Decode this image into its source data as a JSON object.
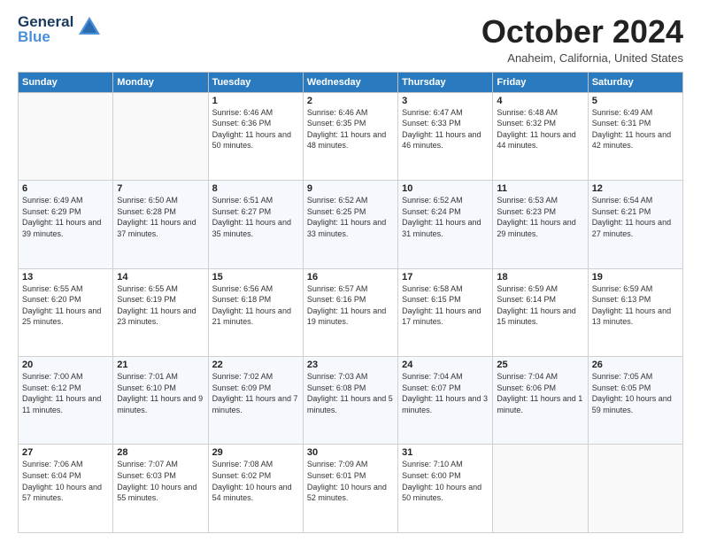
{
  "logo": {
    "line1": "General",
    "line2": "Blue"
  },
  "title": "October 2024",
  "subtitle": "Anaheim, California, United States",
  "days_of_week": [
    "Sunday",
    "Monday",
    "Tuesday",
    "Wednesday",
    "Thursday",
    "Friday",
    "Saturday"
  ],
  "weeks": [
    [
      {
        "day": "",
        "info": ""
      },
      {
        "day": "",
        "info": ""
      },
      {
        "day": "1",
        "info": "Sunrise: 6:46 AM\nSunset: 6:36 PM\nDaylight: 11 hours and 50 minutes."
      },
      {
        "day": "2",
        "info": "Sunrise: 6:46 AM\nSunset: 6:35 PM\nDaylight: 11 hours and 48 minutes."
      },
      {
        "day": "3",
        "info": "Sunrise: 6:47 AM\nSunset: 6:33 PM\nDaylight: 11 hours and 46 minutes."
      },
      {
        "day": "4",
        "info": "Sunrise: 6:48 AM\nSunset: 6:32 PM\nDaylight: 11 hours and 44 minutes."
      },
      {
        "day": "5",
        "info": "Sunrise: 6:49 AM\nSunset: 6:31 PM\nDaylight: 11 hours and 42 minutes."
      }
    ],
    [
      {
        "day": "6",
        "info": "Sunrise: 6:49 AM\nSunset: 6:29 PM\nDaylight: 11 hours and 39 minutes."
      },
      {
        "day": "7",
        "info": "Sunrise: 6:50 AM\nSunset: 6:28 PM\nDaylight: 11 hours and 37 minutes."
      },
      {
        "day": "8",
        "info": "Sunrise: 6:51 AM\nSunset: 6:27 PM\nDaylight: 11 hours and 35 minutes."
      },
      {
        "day": "9",
        "info": "Sunrise: 6:52 AM\nSunset: 6:25 PM\nDaylight: 11 hours and 33 minutes."
      },
      {
        "day": "10",
        "info": "Sunrise: 6:52 AM\nSunset: 6:24 PM\nDaylight: 11 hours and 31 minutes."
      },
      {
        "day": "11",
        "info": "Sunrise: 6:53 AM\nSunset: 6:23 PM\nDaylight: 11 hours and 29 minutes."
      },
      {
        "day": "12",
        "info": "Sunrise: 6:54 AM\nSunset: 6:21 PM\nDaylight: 11 hours and 27 minutes."
      }
    ],
    [
      {
        "day": "13",
        "info": "Sunrise: 6:55 AM\nSunset: 6:20 PM\nDaylight: 11 hours and 25 minutes."
      },
      {
        "day": "14",
        "info": "Sunrise: 6:55 AM\nSunset: 6:19 PM\nDaylight: 11 hours and 23 minutes."
      },
      {
        "day": "15",
        "info": "Sunrise: 6:56 AM\nSunset: 6:18 PM\nDaylight: 11 hours and 21 minutes."
      },
      {
        "day": "16",
        "info": "Sunrise: 6:57 AM\nSunset: 6:16 PM\nDaylight: 11 hours and 19 minutes."
      },
      {
        "day": "17",
        "info": "Sunrise: 6:58 AM\nSunset: 6:15 PM\nDaylight: 11 hours and 17 minutes."
      },
      {
        "day": "18",
        "info": "Sunrise: 6:59 AM\nSunset: 6:14 PM\nDaylight: 11 hours and 15 minutes."
      },
      {
        "day": "19",
        "info": "Sunrise: 6:59 AM\nSunset: 6:13 PM\nDaylight: 11 hours and 13 minutes."
      }
    ],
    [
      {
        "day": "20",
        "info": "Sunrise: 7:00 AM\nSunset: 6:12 PM\nDaylight: 11 hours and 11 minutes."
      },
      {
        "day": "21",
        "info": "Sunrise: 7:01 AM\nSunset: 6:10 PM\nDaylight: 11 hours and 9 minutes."
      },
      {
        "day": "22",
        "info": "Sunrise: 7:02 AM\nSunset: 6:09 PM\nDaylight: 11 hours and 7 minutes."
      },
      {
        "day": "23",
        "info": "Sunrise: 7:03 AM\nSunset: 6:08 PM\nDaylight: 11 hours and 5 minutes."
      },
      {
        "day": "24",
        "info": "Sunrise: 7:04 AM\nSunset: 6:07 PM\nDaylight: 11 hours and 3 minutes."
      },
      {
        "day": "25",
        "info": "Sunrise: 7:04 AM\nSunset: 6:06 PM\nDaylight: 11 hours and 1 minute."
      },
      {
        "day": "26",
        "info": "Sunrise: 7:05 AM\nSunset: 6:05 PM\nDaylight: 10 hours and 59 minutes."
      }
    ],
    [
      {
        "day": "27",
        "info": "Sunrise: 7:06 AM\nSunset: 6:04 PM\nDaylight: 10 hours and 57 minutes."
      },
      {
        "day": "28",
        "info": "Sunrise: 7:07 AM\nSunset: 6:03 PM\nDaylight: 10 hours and 55 minutes."
      },
      {
        "day": "29",
        "info": "Sunrise: 7:08 AM\nSunset: 6:02 PM\nDaylight: 10 hours and 54 minutes."
      },
      {
        "day": "30",
        "info": "Sunrise: 7:09 AM\nSunset: 6:01 PM\nDaylight: 10 hours and 52 minutes."
      },
      {
        "day": "31",
        "info": "Sunrise: 7:10 AM\nSunset: 6:00 PM\nDaylight: 10 hours and 50 minutes."
      },
      {
        "day": "",
        "info": ""
      },
      {
        "day": "",
        "info": ""
      }
    ]
  ]
}
